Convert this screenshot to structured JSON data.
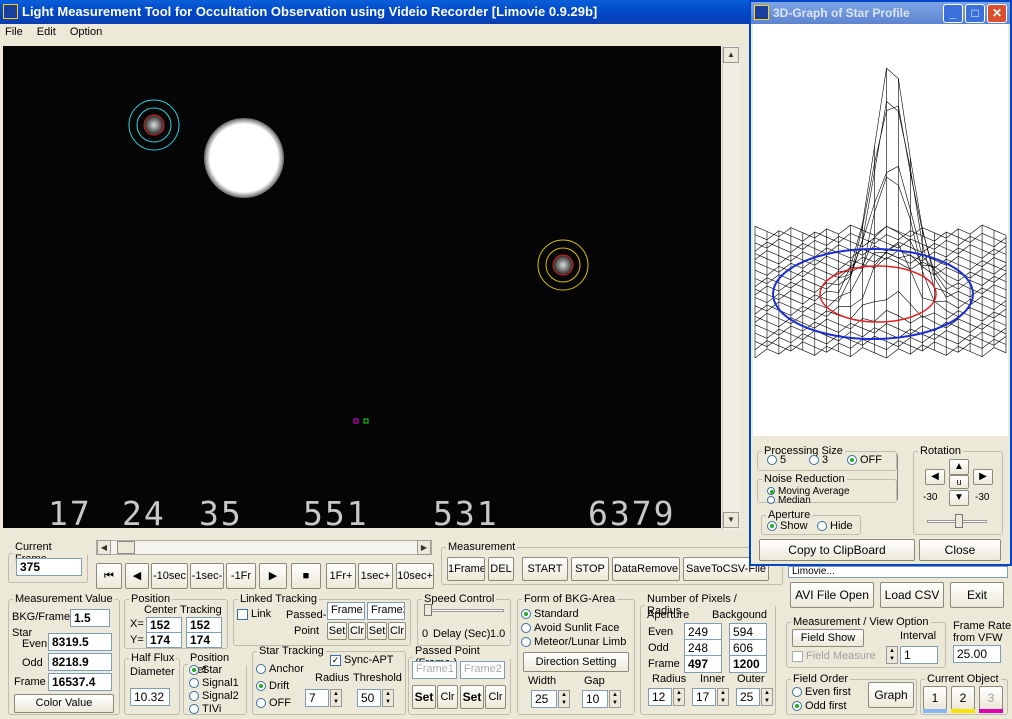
{
  "app": {
    "title": "Light Measurement Tool for Occultation Observation using Videio Recorder [Limovie 0.9.29b]",
    "menu": [
      "File",
      "Edit",
      "Option"
    ]
  },
  "video": {
    "timestamp": [
      "17",
      "24",
      "35",
      "551",
      "531",
      "6379"
    ]
  },
  "frame": {
    "legend": "Current Frame",
    "value": "375"
  },
  "nav": {
    "first": "⏮",
    "prev": "◀",
    "m10sec": "-10sec",
    "m1sec": "-1sec-",
    "m1fr": "-1Fr",
    "play": "▶",
    "stop": "■",
    "p1fr": "1Fr+",
    "p1sec": "1sec+",
    "p10sec": "10sec+"
  },
  "measurement": {
    "legend": "Measurement",
    "oneframe": "1Frame",
    "del": "DEL",
    "start": "START",
    "stop": "STOP",
    "dataremove": "DataRemove",
    "savecsv": "SaveToCSV-File"
  },
  "mv": {
    "legend": "Measurement Value",
    "bkg_label": "BKG/Frame",
    "bkg": "1.5",
    "star_label": "Star",
    "even_label": "Even",
    "even": "8319.5",
    "odd_label": "Odd",
    "odd": "8218.9",
    "frame_label": "Frame",
    "frame": "16537.4",
    "color_btn": "Color Value"
  },
  "position": {
    "legend": "Position",
    "center": "Center",
    "tracking": "Tracking",
    "x_label": "X=",
    "y_label": "Y=",
    "cx": "152",
    "tx": "152",
    "cy": "174",
    "ty": "174"
  },
  "halfflux": {
    "legend": "Half Flux",
    "diameter_label": "Diameter",
    "value": "10.32"
  },
  "linked": {
    "legend": "Linked Tracking",
    "link": "Link",
    "passed": "Passed-",
    "point": "Point",
    "frame1": "Frame1",
    "frame2": "Frame2",
    "set": "Set",
    "clr": "Clr"
  },
  "speed": {
    "legend": "Speed Control",
    "zero": "0",
    "delay": "Delay (Sec)",
    "max": "1.0"
  },
  "bkgform": {
    "legend": "Form of BKG-Area",
    "opts": [
      "Standard",
      "Avoid Sunlit Face",
      "Meteor/Lunar Limb"
    ],
    "dir_btn": "Direction Setting",
    "width_label": "Width",
    "gap_label": "Gap",
    "width": "25",
    "gap": "10"
  },
  "pixels": {
    "legend": "Number of Pixels / Radius",
    "aperture": "Aperture",
    "background": "Backgound",
    "even_label": "Even",
    "odd_label": "Odd",
    "frame_label": "Frame",
    "ap_even": "249",
    "ap_odd": "248",
    "ap_frame": "497",
    "bg_even": "594",
    "bg_odd": "606",
    "bg_frame": "1200",
    "radius_label": "Radius",
    "inner_label": "Inner",
    "outer_label": "Outer",
    "radius": "12",
    "inner": "17",
    "outer": "25"
  },
  "posset": {
    "legend": "Position Set",
    "opts": [
      "Star",
      "Signal1",
      "Signal2",
      "TIVi"
    ]
  },
  "startrack": {
    "legend": "Star Tracking",
    "opts": [
      "Anchor",
      "Drift",
      "OFF"
    ],
    "sync": "Sync-APT",
    "radius_label": "Radius",
    "threshold_label": "Threshold",
    "radius": "7",
    "threshold": "50"
  },
  "passed": {
    "legend": "Passed Point (Frame.)",
    "frame1": "Frame1",
    "frame2": "Frame2",
    "set": "Set",
    "clr": "Clr"
  },
  "rightpanel": {
    "filename": "Limovie...",
    "avi": "AVI File Open",
    "loadcsv": "Load CSV",
    "exit": "Exit"
  },
  "view": {
    "legend": "Measurement / View Option",
    "fieldshow": "Field Show",
    "interval_label": "Interval",
    "fieldmeasure": "Field Measure",
    "interval": "1"
  },
  "framerate": {
    "label1": "Frame Rate",
    "label2": "from VFW",
    "value": "25.00"
  },
  "fieldorder": {
    "legend": "Field Order",
    "opts": [
      "Even first",
      "Odd first"
    ],
    "graph": "Graph"
  },
  "curobj": {
    "legend": "Current Object",
    "items": [
      "1",
      "2",
      "3"
    ],
    "colors": [
      "#8ab4f8",
      "#f5e400",
      "#e000b0"
    ]
  },
  "graph": {
    "title": "3D-Graph of Star Profile",
    "min": "_",
    "max": "□",
    "close": "✕",
    "procsize": {
      "legend": "Processing Size",
      "opts": [
        "5",
        "3",
        "OFF"
      ]
    },
    "noise": {
      "legend": "Noise Reduction",
      "opts": [
        "Moving Average",
        "Median"
      ]
    },
    "aperture": {
      "legend": "Aperture",
      "opts": [
        "Show",
        "Hide"
      ]
    },
    "rotation": {
      "legend": "Rotation",
      "left": "-30",
      "right": "-30",
      "center": "u"
    },
    "copy": "Copy to ClipBoard",
    "close_btn": "Close"
  }
}
